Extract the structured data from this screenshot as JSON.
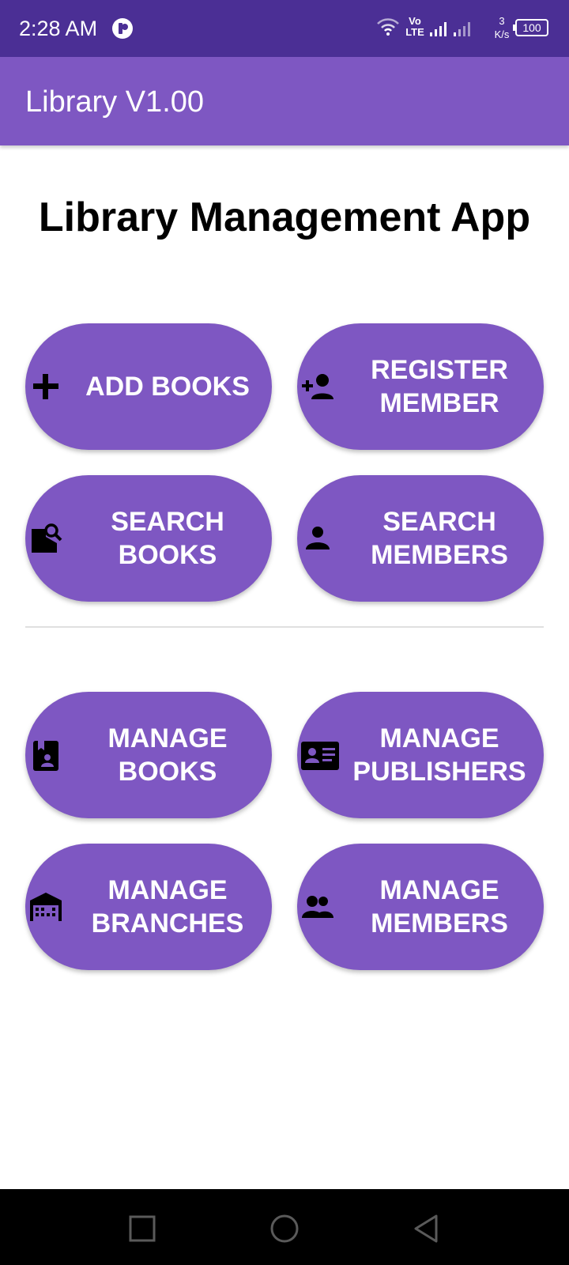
{
  "status_bar": {
    "time": "2:28 AM",
    "network_type": "Vo LTE",
    "speed_value": "3",
    "speed_unit": "K/s",
    "battery": "100"
  },
  "app_bar": {
    "title": "Library V1.00"
  },
  "page": {
    "title": "Library Management App"
  },
  "tiles": [
    {
      "label": "ADD BOOKS",
      "icon": "plus-icon"
    },
    {
      "label": "REGISTER MEMBER",
      "icon": "person-add-icon"
    },
    {
      "label": "SEARCH BOOKS",
      "icon": "search-book-icon"
    },
    {
      "label": "SEARCH MEMBERS",
      "icon": "person-icon"
    },
    {
      "label": "MANAGE BOOKS",
      "icon": "book-person-icon"
    },
    {
      "label": "MANAGE PUBLISHERS",
      "icon": "id-card-icon"
    },
    {
      "label": "MANAGE BRANCHES",
      "icon": "warehouse-icon"
    },
    {
      "label": "MANAGE MEMBERS",
      "icon": "people-icon"
    }
  ],
  "nav": {
    "recent": "square-icon",
    "home": "circle-icon",
    "back": "triangle-back-icon"
  },
  "colors": {
    "status_bar": "#4b2f95",
    "primary": "#7e57c2",
    "nav_bar": "#000000"
  }
}
